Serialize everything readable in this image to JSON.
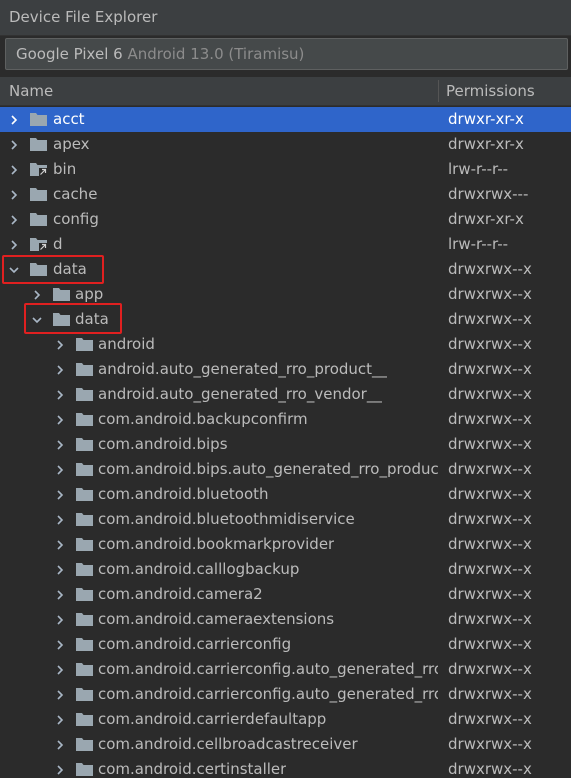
{
  "window": {
    "title": "Device File Explorer"
  },
  "device": {
    "name": "Google Pixel 6",
    "os": "Android 13.0 (Tiramisu)"
  },
  "columns": {
    "name": "Name",
    "permissions": "Permissions"
  },
  "rows": [
    {
      "name": "acct",
      "perm": "drwxr-xr-x",
      "depth": 0,
      "expanded": false,
      "selected": true,
      "link": false
    },
    {
      "name": "apex",
      "perm": "drwxr-xr-x",
      "depth": 0,
      "expanded": false,
      "selected": false,
      "link": false
    },
    {
      "name": "bin",
      "perm": "lrw-r--r--",
      "depth": 0,
      "expanded": false,
      "selected": false,
      "link": true
    },
    {
      "name": "cache",
      "perm": "drwxrwx---",
      "depth": 0,
      "expanded": false,
      "selected": false,
      "link": false
    },
    {
      "name": "config",
      "perm": "drwxr-xr-x",
      "depth": 0,
      "expanded": false,
      "selected": false,
      "link": false
    },
    {
      "name": "d",
      "perm": "lrw-r--r--",
      "depth": 0,
      "expanded": false,
      "selected": false,
      "link": true
    },
    {
      "name": "data",
      "perm": "drwxrwx--x",
      "depth": 0,
      "expanded": true,
      "selected": false,
      "link": false,
      "highlighted": true
    },
    {
      "name": "app",
      "perm": "drwxrwx--x",
      "depth": 1,
      "expanded": false,
      "selected": false,
      "link": false
    },
    {
      "name": "data",
      "perm": "drwxrwx--x",
      "depth": 1,
      "expanded": true,
      "selected": false,
      "link": false,
      "highlighted": true
    },
    {
      "name": "android",
      "perm": "drwxrwx--x",
      "depth": 2,
      "expanded": false,
      "selected": false,
      "link": false
    },
    {
      "name": "android.auto_generated_rro_product__",
      "perm": "drwxrwx--x",
      "depth": 2,
      "expanded": false,
      "selected": false,
      "link": false
    },
    {
      "name": "android.auto_generated_rro_vendor__",
      "perm": "drwxrwx--x",
      "depth": 2,
      "expanded": false,
      "selected": false,
      "link": false
    },
    {
      "name": "com.android.backupconfirm",
      "perm": "drwxrwx--x",
      "depth": 2,
      "expanded": false,
      "selected": false,
      "link": false
    },
    {
      "name": "com.android.bips",
      "perm": "drwxrwx--x",
      "depth": 2,
      "expanded": false,
      "selected": false,
      "link": false
    },
    {
      "name": "com.android.bips.auto_generated_rro_product",
      "perm": "drwxrwx--x",
      "depth": 2,
      "expanded": false,
      "selected": false,
      "link": false
    },
    {
      "name": "com.android.bluetooth",
      "perm": "drwxrwx--x",
      "depth": 2,
      "expanded": false,
      "selected": false,
      "link": false
    },
    {
      "name": "com.android.bluetoothmidiservice",
      "perm": "drwxrwx--x",
      "depth": 2,
      "expanded": false,
      "selected": false,
      "link": false
    },
    {
      "name": "com.android.bookmarkprovider",
      "perm": "drwxrwx--x",
      "depth": 2,
      "expanded": false,
      "selected": false,
      "link": false
    },
    {
      "name": "com.android.calllogbackup",
      "perm": "drwxrwx--x",
      "depth": 2,
      "expanded": false,
      "selected": false,
      "link": false
    },
    {
      "name": "com.android.camera2",
      "perm": "drwxrwx--x",
      "depth": 2,
      "expanded": false,
      "selected": false,
      "link": false
    },
    {
      "name": "com.android.cameraextensions",
      "perm": "drwxrwx--x",
      "depth": 2,
      "expanded": false,
      "selected": false,
      "link": false
    },
    {
      "name": "com.android.carrierconfig",
      "perm": "drwxrwx--x",
      "depth": 2,
      "expanded": false,
      "selected": false,
      "link": false
    },
    {
      "name": "com.android.carrierconfig.auto_generated_rro",
      "perm": "drwxrwx--x",
      "depth": 2,
      "expanded": false,
      "selected": false,
      "link": false
    },
    {
      "name": "com.android.carrierconfig.auto_generated_rro",
      "perm": "drwxrwx--x",
      "depth": 2,
      "expanded": false,
      "selected": false,
      "link": false
    },
    {
      "name": "com.android.carrierdefaultapp",
      "perm": "drwxrwx--x",
      "depth": 2,
      "expanded": false,
      "selected": false,
      "link": false
    },
    {
      "name": "com.android.cellbroadcastreceiver",
      "perm": "drwxrwx--x",
      "depth": 2,
      "expanded": false,
      "selected": false,
      "link": false
    },
    {
      "name": "com.android.certinstaller",
      "perm": "drwxrwx--x",
      "depth": 2,
      "expanded": false,
      "selected": false,
      "link": false
    }
  ],
  "colors": {
    "background": "#2b2b2b",
    "selection": "#2f65ca",
    "highlight": "#e02020",
    "folder": "#9aa7b0",
    "text": "#bbbbbb"
  },
  "icons": {
    "collapsed": "chevron-right-icon",
    "expanded": "chevron-down-icon",
    "folder": "folder-icon",
    "symlink": "symlink-folder-icon"
  }
}
